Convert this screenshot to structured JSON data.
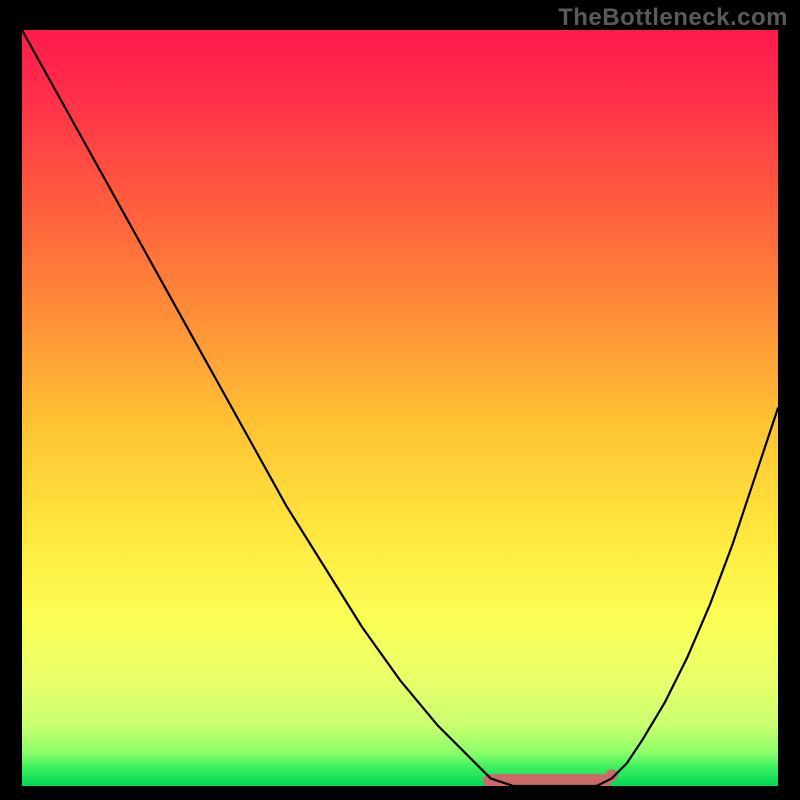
{
  "watermark": "TheBottleneck.com",
  "chart_data": {
    "type": "line",
    "title": "",
    "xlabel": "",
    "ylabel": "",
    "xlim": [
      0,
      100
    ],
    "ylim": [
      0,
      100
    ],
    "grid": false,
    "legend": false,
    "background_gradient": {
      "top_color": "#ff1a4b",
      "mid_colors": [
        "#ff6a3a",
        "#ffc233",
        "#fff04a",
        "#f7ff69"
      ],
      "bottom_color": "#00e05a"
    },
    "series": [
      {
        "name": "bottleneck-curve",
        "color": "#000000",
        "x": [
          0,
          5,
          10,
          15,
          20,
          25,
          30,
          35,
          40,
          45,
          50,
          55,
          60,
          62,
          65,
          68,
          72,
          76,
          78,
          80,
          82,
          85,
          88,
          91,
          94,
          97,
          100
        ],
        "y": [
          100,
          91,
          82,
          73,
          64,
          55,
          46,
          37,
          29,
          21,
          14,
          8,
          3,
          1,
          0,
          0,
          0,
          0,
          1,
          3,
          6,
          11,
          17,
          24,
          32,
          41,
          50
        ]
      }
    ],
    "highlight_band": {
      "name": "optimal-range",
      "color": "#cc6a6a",
      "x_start": 61,
      "x_end": 78,
      "y": 0
    }
  }
}
